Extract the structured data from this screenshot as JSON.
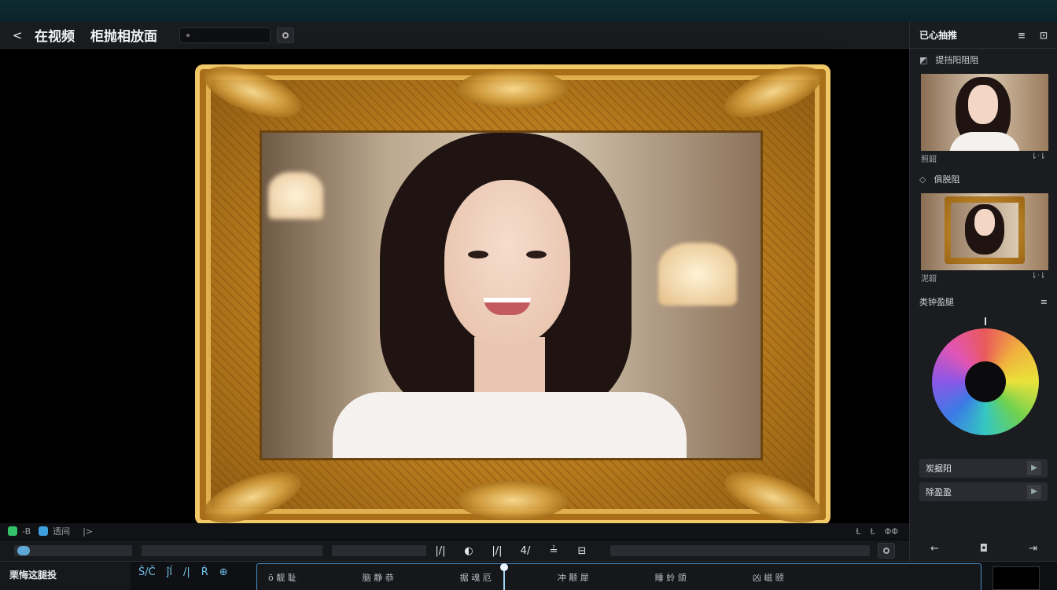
{
  "toolbar": {
    "back_icon": "<",
    "title_1": "在视频",
    "title_2": "柜抛相放面"
  },
  "viewer": {
    "image_description_icon": "framed-portrait"
  },
  "controls": {
    "left_label_1": "-B",
    "left_label_2": "透间",
    "left_label_3": "|>",
    "right_1": "Ƚ",
    "right_2": "Ƚ",
    "right_3": "ΦΦ"
  },
  "transport": {
    "icons": [
      "|/|",
      "◐",
      "|/|",
      "4/",
      "≟",
      "⊟"
    ]
  },
  "timeline": {
    "left_label": "栗悔这腿投",
    "tools": [
      "Š/Č",
      "ĵĺ",
      "/|",
      "Ŕ",
      "⊕"
    ],
    "track_labels": [
      "ō 靓 耻",
      "脑 静 恭",
      "据 魂 厄",
      "冲 颟 犀",
      "睡 蛉 颌",
      "凶 嵫 颐"
    ]
  },
  "sidebar": {
    "title": "已心抽推",
    "section_1": "提挡阳阻阻",
    "meta_1_left": "照韶",
    "meta_1_right": "⇂ᐧ⇂",
    "section_2": "俱脱阻",
    "meta_2_left": "泥韶",
    "meta_2_right": "⇂ᐧ⇂",
    "section_3": "类钟盈腿",
    "button_1": "炭据阳",
    "button_2": "除盈盈",
    "footer_icons": [
      "←",
      "◘",
      "⇥"
    ]
  }
}
